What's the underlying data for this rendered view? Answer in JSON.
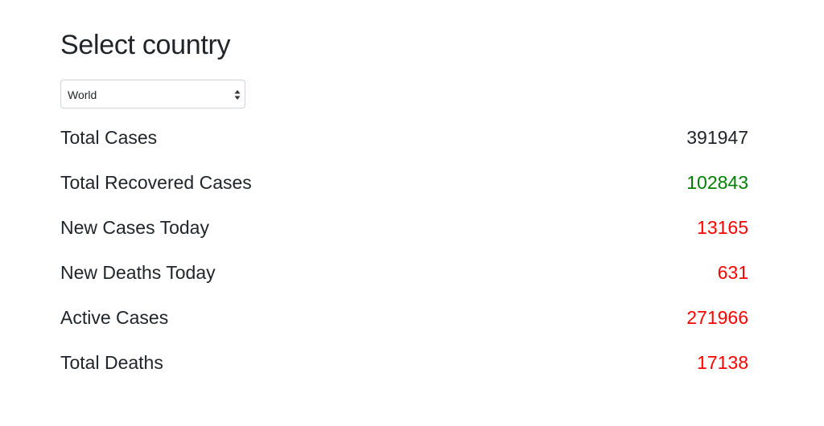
{
  "header": {
    "title": "Select country"
  },
  "country_select": {
    "selected": "World",
    "icon": "select-arrows-icon"
  },
  "stats": [
    {
      "label": "Total Cases",
      "value": "391947",
      "color": "#212529"
    },
    {
      "label": "Total Recovered Cases",
      "value": "102843",
      "color": "#008000"
    },
    {
      "label": "New Cases Today",
      "value": "13165",
      "color": "#ff0000"
    },
    {
      "label": "New Deaths Today",
      "value": "631",
      "color": "#ff0000"
    },
    {
      "label": "Active Cases",
      "value": "271966",
      "color": "#ff0000"
    },
    {
      "label": "Total Deaths",
      "value": "17138",
      "color": "#ff0000"
    }
  ]
}
